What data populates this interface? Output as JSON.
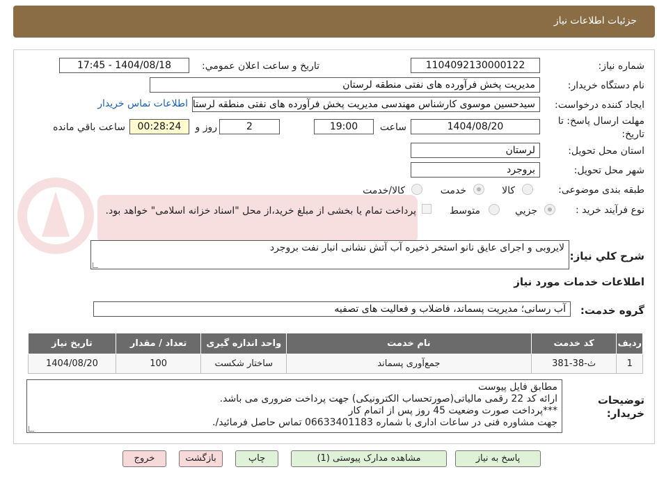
{
  "header": {
    "title": "جزئیات اطلاعات نیاز"
  },
  "form": {
    "need_number_label": "شماره نیاز:",
    "need_number": "1104092130000122",
    "announce_label": "تاریخ و ساعت اعلان عمومي:",
    "announce_value": "1404/08/18 - 17:45",
    "buyer_org_label": "نام دستگاه خريدار:",
    "buyer_org": "مديريت پخش فرآورده هاى نفتى منطقه لرستان",
    "requester_label": "ايجاد كننده درخواست:",
    "requester": "سیدحسین موسوی کارشناس مهندسی مدیریت پخش فرآورده های نفتی منطقه لرستان",
    "contact_link": "اطلاعات تماس خريدار",
    "deadline_label_1": "مهلت ارسال پاسخ: تا",
    "deadline_label_2": "تاريخ:",
    "deadline_date": "1404/08/20",
    "hour_label": "ساعت",
    "deadline_hour": "19:00",
    "days_value": "2",
    "days_label": "روز و",
    "remaining_time": "00:28:24",
    "remaining_label": "ساعت باقي مانده",
    "province_label": "استان محل تحویل:",
    "province": "لرستان",
    "city_label": "شهر محل تحویل:",
    "city": "بروجرد",
    "category_label": "طبقه بندی موضوعی:",
    "category_options": [
      "كالا",
      "خدمت",
      "كالا/خدمت"
    ],
    "category_selected": "خدمت",
    "process_label": "نوع فرآیند خرید :",
    "process_options": [
      "جزيي",
      "متوسط"
    ],
    "process_selected": "جزيي",
    "process_note": "پرداخت تمام یا بخشی از مبلغ خرید،از محل \"اسناد خزانه اسلامی\" خواهد بود."
  },
  "summary": {
    "label": "شرح كلي نياز:",
    "text": "لایروبی و اجرای عایق نانو استخر ذخیره آب آتش نشانی انبار نفت بروجرد"
  },
  "services": {
    "section_title": "اطلاعات خدمات مورد نياز",
    "group_label": "گروه خدمت:",
    "group_value": "آب رسانی؛ مدیریت پسماند، فاضلاب و فعالیت های تصفیه",
    "columns": [
      "رديف",
      "كد خدمت",
      "نام خدمت",
      "واحد اندازه گيری",
      "تعداد / مقدار",
      "تاريخ نياز"
    ],
    "rows": [
      [
        "1",
        "ث-38-381",
        "جمع‌آوری پسماند",
        "ساختار شکست",
        "100",
        "1404/08/20"
      ]
    ]
  },
  "buyer_notes": {
    "label_1": "توضيحات",
    "label_2": "خريدار:",
    "lines": [
      "مطابق فایل پیوست",
      "ارائه کد 22 رقمی مالیاتی(صورتحساب الکترونیکی) جهت پرداخت ضروری می باشد.",
      "***پرداخت صورت وضعیت 45 روز پس از اتمام کار",
      "جهت مشاوره فنی در ساعات اداری با شماره 06633401183  تماس حاصل فرمائید/."
    ]
  },
  "buttons": {
    "reply": "پاسخ به نياز",
    "attachments": "مشاهده مدارک پیوستی (1)",
    "print": "چاپ",
    "back": "بازگشت",
    "exit": "خروج"
  },
  "colors": {
    "header": "#8a6d45",
    "table_header": "#6b6b6b",
    "time_bg": "#fffbd0",
    "link": "#1a5fb4"
  }
}
